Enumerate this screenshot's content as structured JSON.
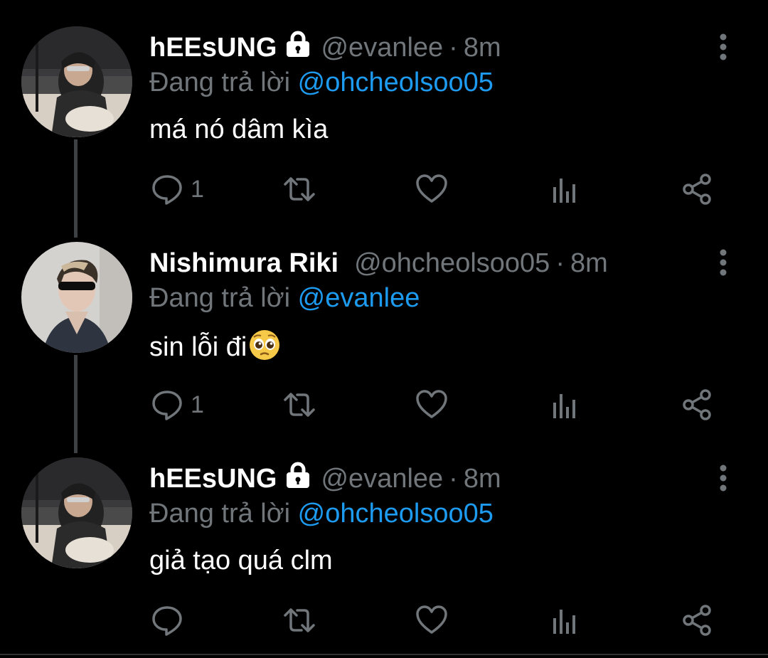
{
  "colors": {
    "background": "#000000",
    "primary_text": "#ffffff",
    "secondary_text": "#71767b",
    "link": "#1d9bf0",
    "thread_line": "#3e4144"
  },
  "tweets": [
    {
      "display_name": "hEEsUNG",
      "locked": true,
      "lock_icon": "lock-icon",
      "handle": "@evanlee",
      "separator": "·",
      "time": "8m",
      "reply_prefix": "Đang trả lời",
      "reply_to": "@ohcheolsoo05",
      "text": "má nó dâm kìa",
      "emoji": "",
      "reply_count": "1"
    },
    {
      "display_name": "Nishimura Riki",
      "locked": false,
      "handle": "@ohcheolsoo05",
      "separator": "·",
      "time": "8m",
      "reply_prefix": "Đang trả lời",
      "reply_to": "@evanlee",
      "text": "sin lỗi đi",
      "emoji": "pleading-face-emoji",
      "reply_count": "1"
    },
    {
      "display_name": "hEEsUNG",
      "locked": true,
      "lock_icon": "lock-icon",
      "handle": "@evanlee",
      "separator": "·",
      "time": "8m",
      "reply_prefix": "Đang trả lời",
      "reply_to": "@ohcheolsoo05",
      "text": "giả tạo quá clm",
      "emoji": "",
      "reply_count": ""
    }
  ],
  "action_icons": [
    "reply-icon",
    "retweet-icon",
    "like-icon",
    "analytics-icon",
    "share-icon"
  ],
  "menu_icon": "more-vertical-icon"
}
